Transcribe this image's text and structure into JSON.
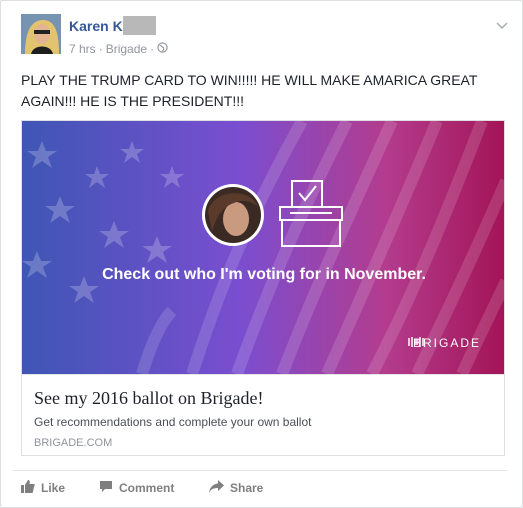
{
  "post": {
    "author": "Karen K",
    "time": "7 hrs",
    "app": "Brigade",
    "separator": "·",
    "text": "PLAY THE TRUMP CARD TO WIN!!!!! HE WILL MAKE AMARICA GREAT AGAIN!!! HE IS THE PRESIDENT!!!"
  },
  "share": {
    "hero_caption": "Check out who I'm voting for in November.",
    "brand": "BRIGADE",
    "title": "See my 2016 ballot on Brigade!",
    "description": "Get recommendations and complete your own ballot",
    "domain": "BRIGADE.COM"
  },
  "actions": {
    "like": "Like",
    "comment": "Comment",
    "share": "Share"
  },
  "colors": {
    "author_link": "#365899",
    "hero_blue": "#3e56b5",
    "hero_purple": "#8b3fbd",
    "hero_magenta": "#a31456"
  },
  "icons": [
    "globe-icon",
    "chevron-down-icon",
    "ballot-box-icon",
    "brigade-logo-icon",
    "like-icon",
    "comment-icon",
    "share-icon"
  ]
}
